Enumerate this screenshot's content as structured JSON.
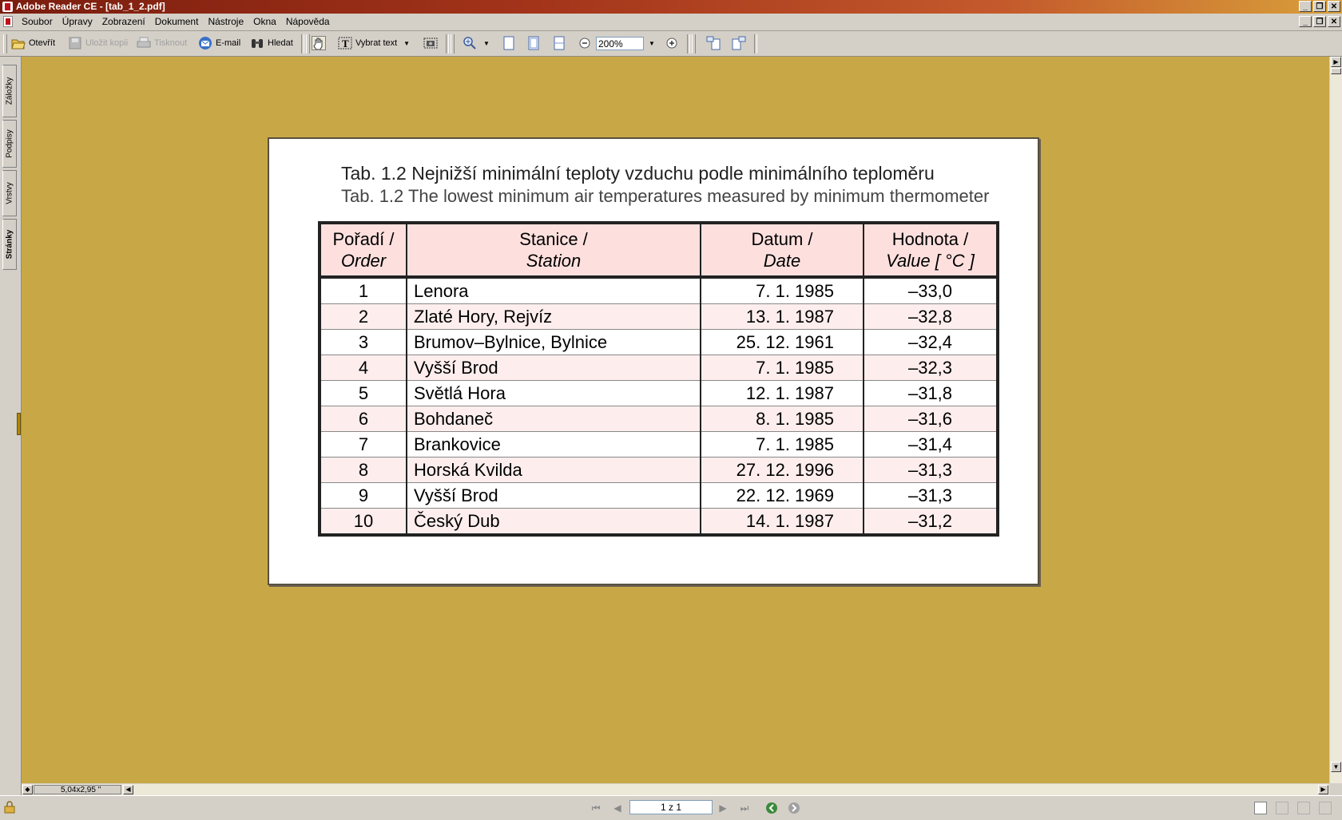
{
  "window": {
    "title": "Adobe Reader CE - [tab_1_2.pdf]"
  },
  "menubar": {
    "items": [
      {
        "label": "Soubor"
      },
      {
        "label": "Úpravy"
      },
      {
        "label": "Zobrazení"
      },
      {
        "label": "Dokument"
      },
      {
        "label": "Nástroje"
      },
      {
        "label": "Okna"
      },
      {
        "label": "Nápověda"
      }
    ]
  },
  "toolbar": {
    "open": "Otevřít",
    "save_copy": "Uložit kopii",
    "print": "Tisknout",
    "email": "E-mail",
    "search": "Hledat",
    "select_text": "Vybrat text",
    "zoom": "200%"
  },
  "sidepanel": {
    "tabs": [
      "Záložky",
      "Podpisy",
      "Vrstvy",
      "Stránky"
    ]
  },
  "scrollbar": {
    "page_size": "5,04x2,95 \""
  },
  "statusbar": {
    "page_indicator": "1 z 1"
  },
  "document": {
    "caption_cz": "Tab. 1.2  Nejnižší minimální teploty vzduchu podle minimálního teploměru",
    "caption_en": "Tab. 1.2  The lowest minimum air temperatures measured by minimum thermometer",
    "table": {
      "headers": [
        {
          "cz": "Pořadí /",
          "en": "Order"
        },
        {
          "cz": "Stanice /",
          "en": "Station"
        },
        {
          "cz": "Datum /",
          "en": "Date"
        },
        {
          "cz": "Hodnota /",
          "en": "Value [ °C ]"
        }
      ],
      "rows": [
        [
          "1",
          "Lenora",
          "7. 1. 1985",
          "–33,0"
        ],
        [
          "2",
          "Zlaté Hory, Rejvíz",
          "13. 1. 1987",
          "–32,8"
        ],
        [
          "3",
          "Brumov–Bylnice, Bylnice",
          "25. 12. 1961",
          "–32,4"
        ],
        [
          "4",
          "Vyšší Brod",
          "7. 1. 1985",
          "–32,3"
        ],
        [
          "5",
          "Světlá Hora",
          "12. 1. 1987",
          "–31,8"
        ],
        [
          "6",
          "Bohdaneč",
          "8. 1. 1985",
          "–31,6"
        ],
        [
          "7",
          "Brankovice",
          "7. 1. 1985",
          "–31,4"
        ],
        [
          "8",
          "Horská Kvilda",
          "27. 12. 1996",
          "–31,3"
        ],
        [
          "9",
          "Vyšší Brod",
          "22. 12. 1969",
          "–31,3"
        ],
        [
          "10",
          "Český Dub",
          "14. 1. 1987",
          "–31,2"
        ]
      ]
    }
  },
  "colors": {
    "workspace": "#c8a846",
    "header_fill": "#fde0de",
    "row_alt_fill": "#fdeeed",
    "titlebar": "#a3341a"
  }
}
